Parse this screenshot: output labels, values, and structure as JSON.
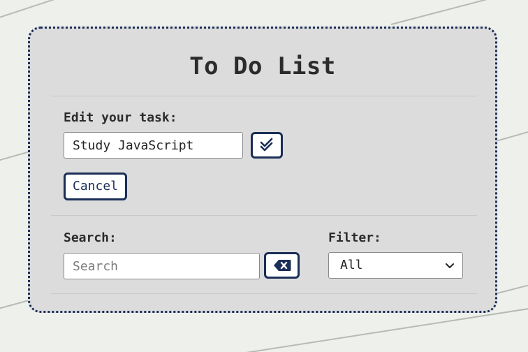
{
  "app": {
    "title": "To Do List"
  },
  "edit": {
    "label": "Edit your task:",
    "value": "Study JavaScript",
    "confirm_icon": "double-check-icon",
    "cancel_label": "Cancel"
  },
  "search": {
    "label": "Search:",
    "placeholder": "Search",
    "value": "",
    "clear_icon": "backspace-icon"
  },
  "filter": {
    "label": "Filter:",
    "selected": "All",
    "icon": "chevron-down-icon"
  },
  "colors": {
    "accent": "#1b2e57",
    "card": "#dcdcdc",
    "text": "#2b2b2b"
  }
}
